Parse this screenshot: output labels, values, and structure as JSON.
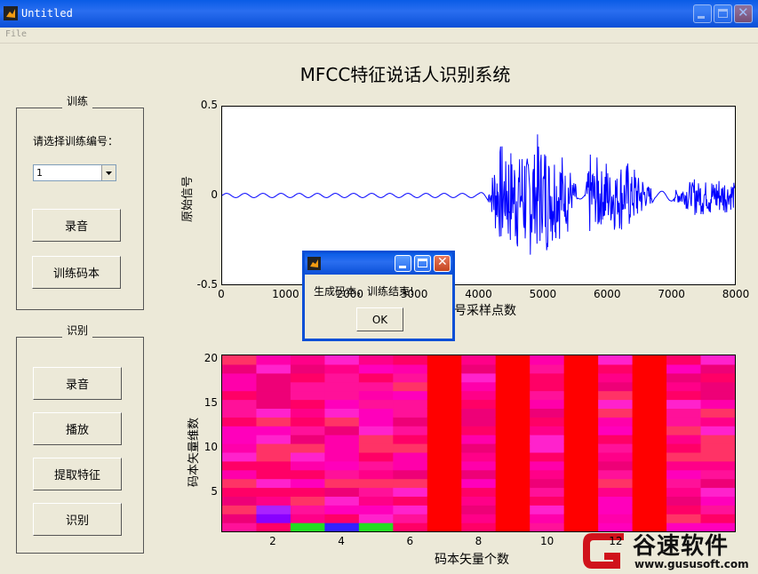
{
  "window": {
    "title": "Untitled"
  },
  "menu": {
    "file": "File"
  },
  "main_title": "MFCC特征说话人识别系统",
  "train_panel": {
    "label": "训练",
    "prompt": "请选择训练编号：",
    "select_value": "1",
    "record_button": "录音",
    "train_button": "训练码本"
  },
  "recog_panel": {
    "label": "识别",
    "record_button": "录音",
    "play_button": "播放",
    "extract_button": "提取特征",
    "recognize_button": "识别"
  },
  "dialog": {
    "message": "生成码本，训练结束!",
    "ok_label": "OK"
  },
  "watermark": {
    "brand": "谷速软件",
    "url": "www.gususoft.com"
  },
  "chart_data": [
    {
      "type": "line",
      "ylabel": "原始信号",
      "xlabel": "号采样点数",
      "xlim": [
        0,
        8000
      ],
      "ylim": [
        -0.5,
        0.5
      ],
      "xticks": [
        "0",
        "1000",
        "2000",
        "3000",
        "4000",
        "5000",
        "6000",
        "7000",
        "8000"
      ],
      "yticks": [
        "0.5",
        "0",
        "-0.5"
      ],
      "color": "#0000ff",
      "envelope": [
        {
          "x": 0,
          "amp": 0.012
        },
        {
          "x": 4000,
          "amp": 0.012
        },
        {
          "x": 4150,
          "amp": 0.03
        },
        {
          "x": 4300,
          "amp": 0.3
        },
        {
          "x": 4600,
          "amp": 0.33
        },
        {
          "x": 4900,
          "amp": 0.38
        },
        {
          "x": 5200,
          "amp": 0.3
        },
        {
          "x": 5400,
          "amp": 0.22
        },
        {
          "x": 5550,
          "amp": 0.02
        },
        {
          "x": 5650,
          "amp": 0.02
        },
        {
          "x": 5720,
          "amp": 0.25
        },
        {
          "x": 6000,
          "amp": 0.22
        },
        {
          "x": 6400,
          "amp": 0.2
        },
        {
          "x": 6750,
          "amp": 0.02
        },
        {
          "x": 7000,
          "amp": 0.03
        },
        {
          "x": 7400,
          "amp": 0.12
        },
        {
          "x": 7800,
          "amp": 0.12
        },
        {
          "x": 8000,
          "amp": 0.08
        }
      ]
    },
    {
      "type": "heatmap",
      "ylabel": "码本矢量维数",
      "xlabel": "码本矢量个数",
      "xlim": [
        0.5,
        15.5
      ],
      "ylim": [
        0.5,
        20.5
      ],
      "xticks": [
        "2",
        "4",
        "6",
        "8",
        "10",
        "12"
      ],
      "yticks": [
        "5",
        "10",
        "15",
        "20"
      ],
      "columns": 15,
      "rows": 20,
      "solid_red_columns": [
        7,
        9,
        11,
        13
      ],
      "special_cells": [
        {
          "col": 2,
          "row": 2,
          "color": "#8800ff"
        },
        {
          "col": 2,
          "row": 3,
          "color": "#aa22ff"
        },
        {
          "col": 3,
          "row": 1,
          "color": "#22dd22"
        },
        {
          "col": 4,
          "row": 1,
          "color": "#3322ff"
        },
        {
          "col": 5,
          "row": 1,
          "color": "#22dd22"
        },
        {
          "col": 9,
          "row": 2,
          "color": "#aa22ff"
        },
        {
          "col": 9,
          "row": 3,
          "color": "#bb33ff"
        },
        {
          "col": 11,
          "row": 1,
          "color": "#3333ff"
        }
      ]
    }
  ]
}
